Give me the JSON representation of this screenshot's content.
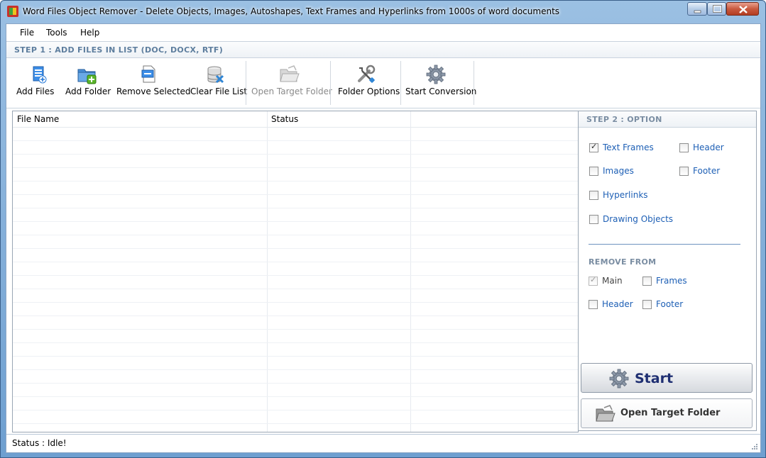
{
  "window": {
    "title": "Word Files Object  Remover - Delete Objects, Images, Autoshapes, Text Frames and Hyperlinks from 1000s of word documents",
    "accent_color": "#6e9fd0"
  },
  "menu": {
    "items": [
      "File",
      "Tools",
      "Help"
    ]
  },
  "step1": {
    "label": "STEP 1 : ADD FILES IN LIST (DOC, DOCX, RTF)"
  },
  "toolbar": {
    "add_files": "Add Files",
    "add_folder": "Add Folder",
    "remove_selected": "Remove Selected",
    "clear_file_list": "Clear File List",
    "open_target_folder": "Open Target Folder",
    "folder_options": "Folder Options",
    "start_conversion": "Start Conversion"
  },
  "grid": {
    "columns": [
      "File Name",
      "Status",
      ""
    ],
    "rows": []
  },
  "step2": {
    "label": "STEP 2 : OPTION",
    "options": {
      "text_frames": {
        "label": "Text Frames",
        "checked": true
      },
      "header": {
        "label": "Header",
        "checked": false
      },
      "images": {
        "label": "Images",
        "checked": false
      },
      "footer": {
        "label": "Footer",
        "checked": false
      },
      "hyperlinks": {
        "label": "Hyperlinks",
        "checked": false
      },
      "drawing_objects": {
        "label": "Drawing Objects",
        "checked": false
      }
    },
    "remove_from": {
      "label": "REMOVE FROM",
      "main": {
        "label": "Main",
        "checked": true,
        "disabled": true
      },
      "frames": {
        "label": "Frames",
        "checked": false
      },
      "header": {
        "label": "Header",
        "checked": false
      },
      "footer": {
        "label": "Footer",
        "checked": false
      }
    }
  },
  "actions": {
    "start": "Start",
    "open_target_folder": "Open Target Folder"
  },
  "status": {
    "text": "Status  :  Idle!"
  }
}
